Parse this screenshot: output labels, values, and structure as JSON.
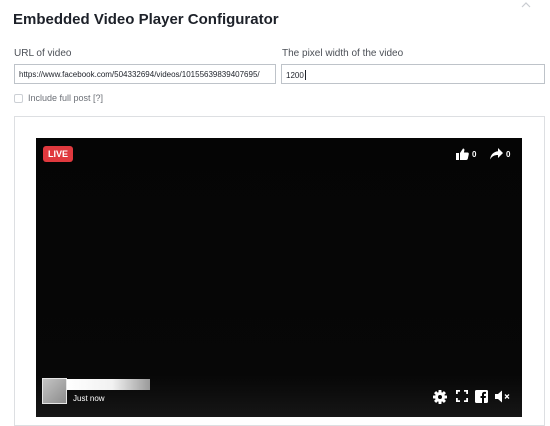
{
  "header": {
    "title": "Embedded Video Player Configurator"
  },
  "form": {
    "url_label": "URL of video",
    "url_value": "https://www.facebook.com/504332694/videos/10155639839407695/",
    "width_label": "The pixel width of the video",
    "width_value": "1200",
    "include_full_post_label": "Include full post [?]",
    "include_full_post_checked": false
  },
  "video": {
    "live_label": "LIVE",
    "likes_count": "0",
    "shares_count": "0",
    "timestamp": "Just now",
    "icons": [
      "thumbs-up-icon",
      "share-arrow-icon",
      "gear-icon",
      "fullscreen-icon",
      "facebook-icon",
      "mute-icon"
    ]
  },
  "colors": {
    "live_badge": "#e0393e",
    "video_bg": "#050505",
    "border": "#dddfe2"
  }
}
